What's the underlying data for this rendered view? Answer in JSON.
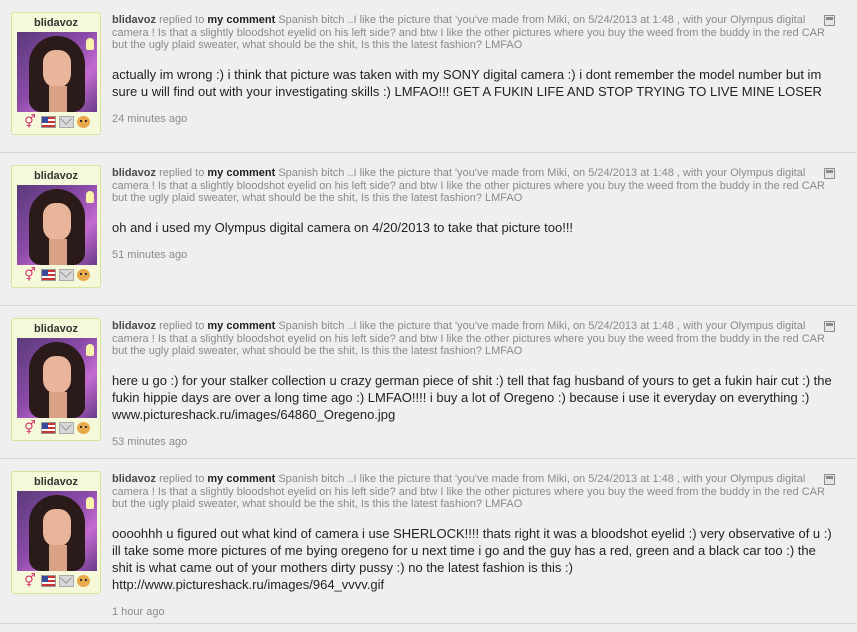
{
  "comments": [
    {
      "username": "blidavoz",
      "author": "blidavoz",
      "verb": "replied to",
      "target": "my comment",
      "quote": "Spanish bitch ..I like the picture that 'you've made from Miki, on 5/24/2013 at 1:48 , with your Olympus digital camera ! Is that a slightly bloodshot eyelid on his left side? and btw I like the other pictures where you buy the weed from the buddy in the red CAR but the ugly plaid sweater, what should be the shit, Is this the latest fashion? LMFAO",
      "message": "actually im wrong :) i think that picture was taken with my SONY digital camera :) i dont remember the model number but im sure u will find out with your investigating skills :) LMFAO!!! GET A FUKIN LIFE AND STOP TRYING TO LIVE MINE LOSER",
      "time": "24 minutes ago"
    },
    {
      "username": "blidavoz",
      "author": "blidavoz",
      "verb": "replied to",
      "target": "my comment",
      "quote": "Spanish bitch ..I like the picture that 'you've made from Miki, on 5/24/2013 at 1:48 , with your Olympus digital camera ! Is that a slightly bloodshot eyelid on his left side? and btw I like the other pictures where you buy the weed from the buddy in the red CAR but the ugly plaid sweater, what should be the shit, Is this the latest fashion? LMFAO",
      "message": "oh and i used my Olympus digital camera on 4/20/2013 to take that picture too!!!",
      "time": "51 minutes ago"
    },
    {
      "username": "blidavoz",
      "author": "blidavoz",
      "verb": "replied to",
      "target": "my comment",
      "quote": "Spanish bitch ..I like the picture that 'you've made from Miki, on 5/24/2013 at 1:48 , with your Olympus digital camera ! Is that a slightly bloodshot eyelid on his left side? and btw I like the other pictures where you buy the weed from the buddy in the red CAR but the ugly plaid sweater, what should be the shit, Is this the latest fashion? LMFAO",
      "message": "here u go :) for your stalker collection u crazy german piece of shit :) tell that fag husband of yours to get a fukin hair cut :) the fukin hippie days are over a long time ago :) LMFAO!!!! i buy a lot of Oregeno :) because i use it everyday on everything :) www.pictureshack.ru/images/64860_Oregeno.jpg",
      "time": "53 minutes ago"
    },
    {
      "username": "blidavoz",
      "author": "blidavoz",
      "verb": "replied to",
      "target": "my comment",
      "quote": "Spanish bitch ..I like the picture that 'you've made from Miki, on 5/24/2013 at 1:48 , with your Olympus digital camera ! Is that a slightly bloodshot eyelid on his left side? and btw I like the other pictures where you buy the weed from the buddy in the red CAR but the ugly plaid sweater, what should be the shit, Is this the latest fashion? LMFAO",
      "message": "oooohhh u figured out what kind of camera i use SHERLOCK!!!! thats right it was a bloodshot eyelid :) very observative of u :) ill take some more pictures of me bying oregeno for u next time i go and the guy has a red, green and a black car too :) the shit is what came out of your mothers dirty pussy :) no the latest fashion is this :) http://www.pictureshack.ru/images/964_vvvv.gif",
      "time": "1 hour ago"
    }
  ]
}
